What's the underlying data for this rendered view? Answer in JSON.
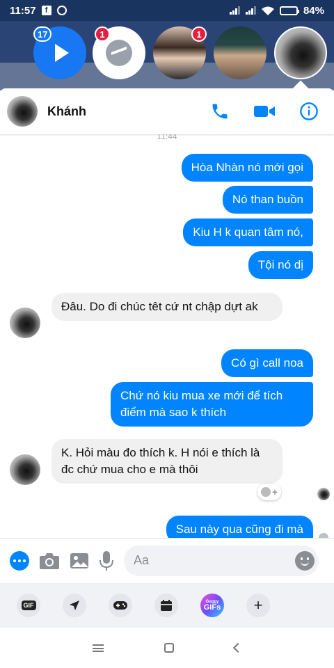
{
  "status_bar": {
    "time": "11:57",
    "battery": "84%",
    "battery_level": 0.84
  },
  "chat_heads": {
    "video_badge": "17",
    "messenger_badge": "1",
    "contact_badge": "1"
  },
  "chat_header": {
    "contact_name": "Khánh",
    "icons": [
      "phone-icon",
      "video-camera-icon",
      "info-icon"
    ]
  },
  "messages": {
    "timestamp": "11:44",
    "items": [
      {
        "direction": "out",
        "text": "Hòa Nhàn nó mới gọi"
      },
      {
        "direction": "out",
        "text": "Nó than buồn"
      },
      {
        "direction": "out",
        "text": "Kiu H k quan tâm nó,"
      },
      {
        "direction": "out",
        "text": "Tội nó dị"
      },
      {
        "direction": "in",
        "text": "Đâu. Do đi chúc têt cứ nt chập dựt ak"
      },
      {
        "direction": "out",
        "text": "Có gì call noa"
      },
      {
        "direction": "out",
        "text": "Chứ nó kiu mua xe mới để tích điểm mà sao k thích"
      },
      {
        "direction": "in",
        "text": "K. Hỏi màu đo thích k. H nói e thích là đc chứ mua cho e mà thôi"
      },
      {
        "direction": "out",
        "text": "Sau này qua cũng đi mà"
      }
    ]
  },
  "composer": {
    "placeholder": "Aa",
    "icons": [
      "more-icon",
      "camera-icon",
      "image-icon",
      "microphone-icon",
      "emoji-icon",
      "thumbs-up-icon"
    ]
  },
  "extras": {
    "gif_label": "GIF",
    "giphy_small": "Guggy",
    "giphy_big": "GIFs",
    "icons": [
      "gif-icon",
      "location-icon",
      "game-controller-icon",
      "calendar-icon",
      "giphy-icon",
      "plus-icon"
    ]
  },
  "colors": {
    "accent": "#0084ff",
    "incoming_bubble": "#f0f0f0",
    "status_bar": "#1a3460"
  }
}
